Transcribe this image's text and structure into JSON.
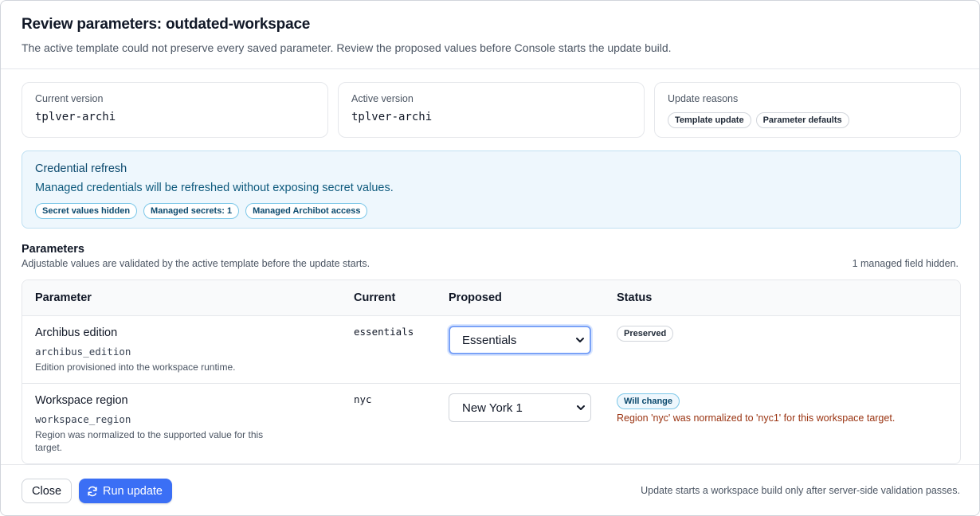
{
  "dialog": {
    "title": "Review parameters: outdated-workspace",
    "subtitle": "The active template could not preserve every saved parameter. Review the proposed values before Console starts the update build."
  },
  "cards": {
    "current": {
      "label": "Current version",
      "value": "tplver-archi"
    },
    "active": {
      "label": "Active version",
      "value": "tplver-archi"
    },
    "reasons": {
      "label": "Update reasons",
      "chips": [
        "Template update",
        "Parameter defaults"
      ]
    }
  },
  "notice": {
    "title": "Credential refresh",
    "text": "Managed credentials will be refreshed without exposing secret values.",
    "chips": [
      "Secret values hidden",
      "Managed secrets: 1",
      "Managed Archibot access"
    ]
  },
  "parameters": {
    "title": "Parameters",
    "subtitle": "Adjustable values are validated by the active template before the update starts.",
    "hidden_note": "1 managed field hidden.",
    "columns": [
      "Parameter",
      "Current",
      "Proposed",
      "Status"
    ],
    "rows": [
      {
        "name": "Archibus edition",
        "key": "archibus_edition",
        "description": "Edition provisioned into the workspace runtime.",
        "current": "essentials",
        "proposed": "Essentials",
        "status": "Preserved",
        "message": ""
      },
      {
        "name": "Workspace region",
        "key": "workspace_region",
        "description": "Region was normalized to the supported value for this target.",
        "current": "nyc",
        "proposed": "New York 1",
        "status": "Will change",
        "message": "Region 'nyc' was normalized to 'nyc1' for this workspace target."
      }
    ]
  },
  "footer": {
    "close_label": "Close",
    "run_label": "Run update",
    "note": "Update starts a workspace build only after server-side validation passes."
  },
  "colors": {
    "primary": "#3b6ff5",
    "notice_bg": "#eef7fd",
    "warning_text": "#9a3412"
  },
  "icons": {
    "run": "refresh-icon",
    "select": "chevron-down-icon"
  }
}
